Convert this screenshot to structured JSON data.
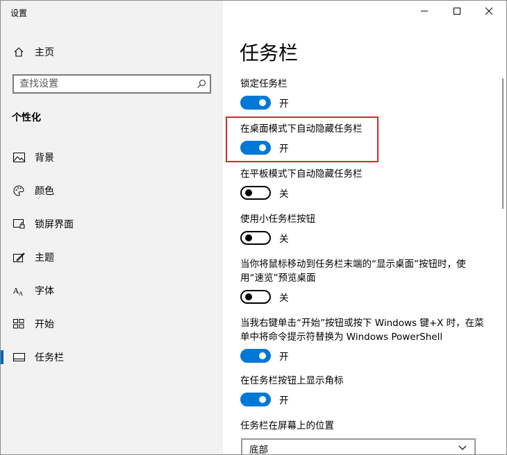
{
  "window": {
    "app_title": "设置"
  },
  "sidebar": {
    "home_label": "主页",
    "search_placeholder": "查找设置",
    "section_title": "个性化",
    "items": [
      {
        "label": "背景",
        "icon": "picture-icon"
      },
      {
        "label": "颜色",
        "icon": "palette-icon"
      },
      {
        "label": "锁屏界面",
        "icon": "lock-screen-icon"
      },
      {
        "label": "主题",
        "icon": "theme-icon"
      },
      {
        "label": "字体",
        "icon": "font-icon"
      },
      {
        "label": "开始",
        "icon": "start-icon"
      },
      {
        "label": "任务栏",
        "icon": "taskbar-icon",
        "active": true
      }
    ]
  },
  "main": {
    "title": "任务栏",
    "settings": [
      {
        "label": "锁定任务栏",
        "state": "开",
        "on": true
      },
      {
        "label": "在桌面模式下自动隐藏任务栏",
        "state": "开",
        "on": true
      },
      {
        "label": "在平板模式下自动隐藏任务栏",
        "state": "关",
        "on": false
      },
      {
        "label": "使用小任务栏按钮",
        "state": "关",
        "on": false
      },
      {
        "label_line1": "当你将鼠标移动到任务栏末端的“显示桌面”按钮时，使",
        "label_line2": "用“速览”预览桌面",
        "state": "关",
        "on": false
      },
      {
        "label_line1": "当我右键单击“开始”按钮或按下 Windows 键+X 时，在菜",
        "label_line2": "单中将命令提示符替换为 Windows PowerShell",
        "state": "开",
        "on": true
      },
      {
        "label": "在任务栏按钮上显示角标",
        "state": "开",
        "on": true
      }
    ],
    "position_label": "任务栏在屏幕上的位置",
    "position_value": "底部"
  },
  "colors": {
    "accent": "#0078d7",
    "highlight_border": "#d9232e",
    "sidebar_bg": "#f2f2f2"
  }
}
